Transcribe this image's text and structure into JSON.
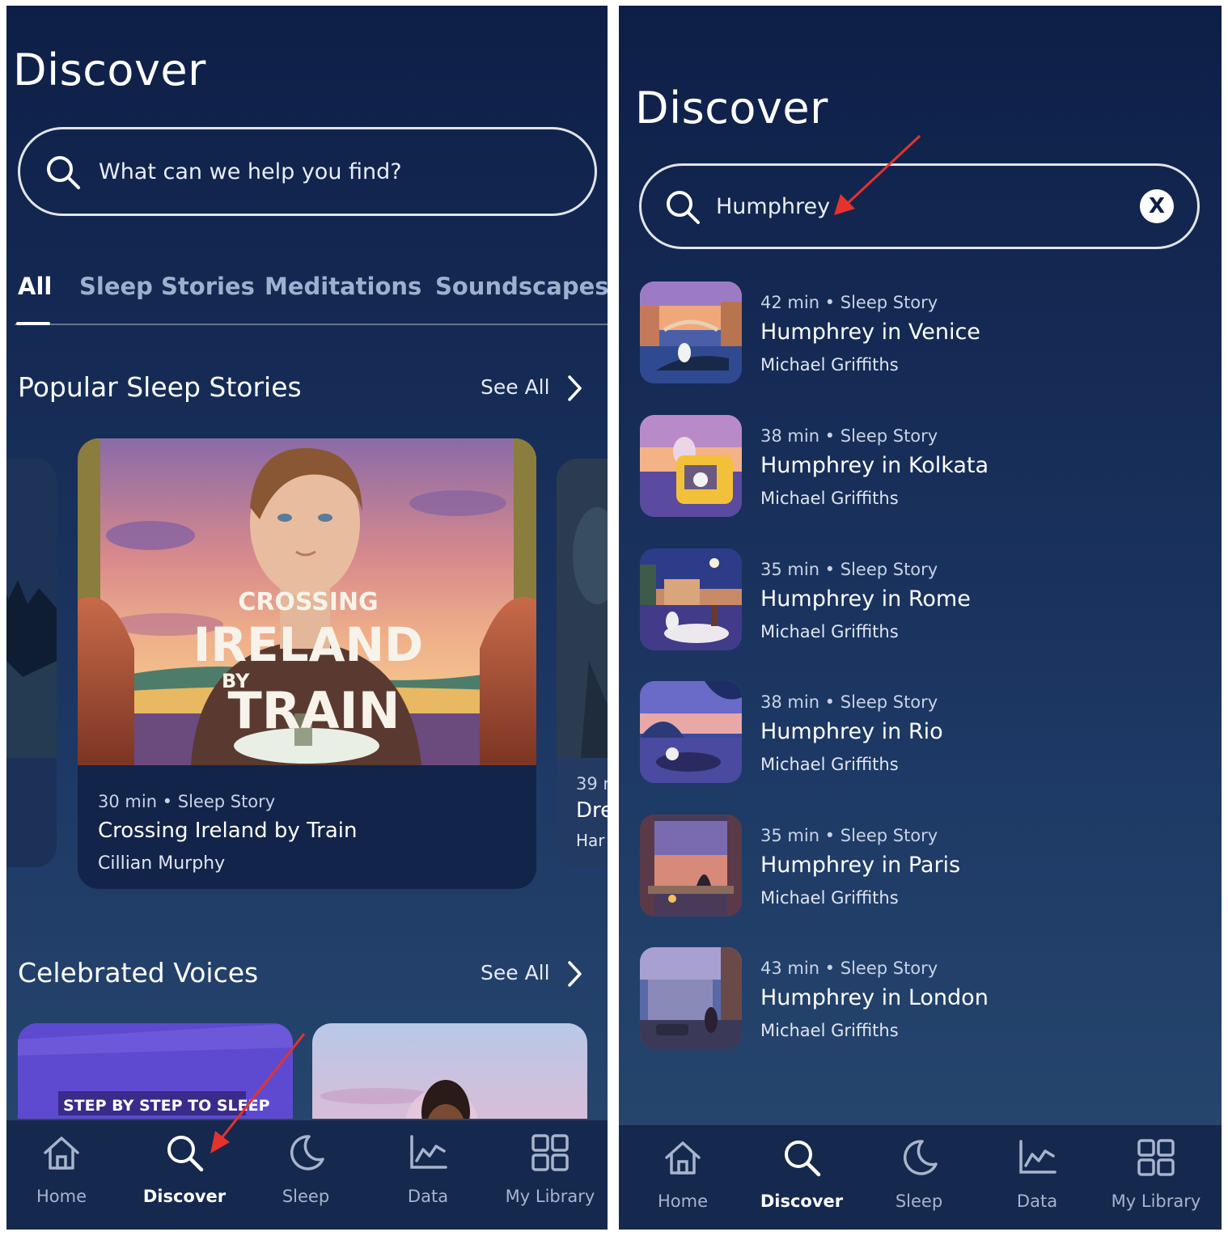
{
  "left": {
    "title": "Discover",
    "search": {
      "placeholder": "What can we help you find?"
    },
    "tabs": [
      {
        "label": "All",
        "active": true
      },
      {
        "label": "Sleep Stories"
      },
      {
        "label": "Meditations"
      },
      {
        "label": "Soundscapes"
      }
    ],
    "popular": {
      "title": "Popular Sleep Stories",
      "see_all": "See All",
      "feature": {
        "art_line1": "CROSSING",
        "art_line2": "IRELAND",
        "art_line3": "BY",
        "art_line4": "TRAIN",
        "meta": "30 min • Sleep Story",
        "title": "Crossing Ireland by Train",
        "author": "Cillian Murphy"
      },
      "peek_card": {
        "meta": "39 r",
        "title": "Dre",
        "author": "Har"
      }
    },
    "voices": {
      "title": "Celebrated Voices",
      "see_all": "See All",
      "card1_label": "STEP BY STEP TO SLEEP"
    }
  },
  "right": {
    "title": "Discover",
    "search": {
      "value": "Humphrey",
      "clear": "X"
    },
    "results": [
      {
        "meta": "42 min • Sleep Story",
        "title": "Humphrey in Venice",
        "author": "Michael Griffiths"
      },
      {
        "meta": "38 min • Sleep Story",
        "title": "Humphrey in Kolkata",
        "author": "Michael Griffiths"
      },
      {
        "meta": "35 min • Sleep Story",
        "title": "Humphrey in Rome",
        "author": "Michael Griffiths"
      },
      {
        "meta": "38 min • Sleep Story",
        "title": "Humphrey in Rio",
        "author": "Michael Griffiths"
      },
      {
        "meta": "35 min • Sleep Story",
        "title": "Humphrey in Paris",
        "author": "Michael Griffiths"
      },
      {
        "meta": "43 min • Sleep Story",
        "title": "Humphrey in London",
        "author": "Michael Griffiths"
      }
    ]
  },
  "nav": [
    {
      "label": "Home",
      "icon": "home-icon"
    },
    {
      "label": "Discover",
      "icon": "search-icon",
      "active": true
    },
    {
      "label": "Sleep",
      "icon": "moon-icon"
    },
    {
      "label": "Data",
      "icon": "chart-icon"
    },
    {
      "label": "My Library",
      "icon": "grid-icon"
    }
  ],
  "colors": {
    "background_top": "#0e1f47",
    "background_bottom": "#28496f",
    "annotation_arrow": "#e5322d"
  }
}
